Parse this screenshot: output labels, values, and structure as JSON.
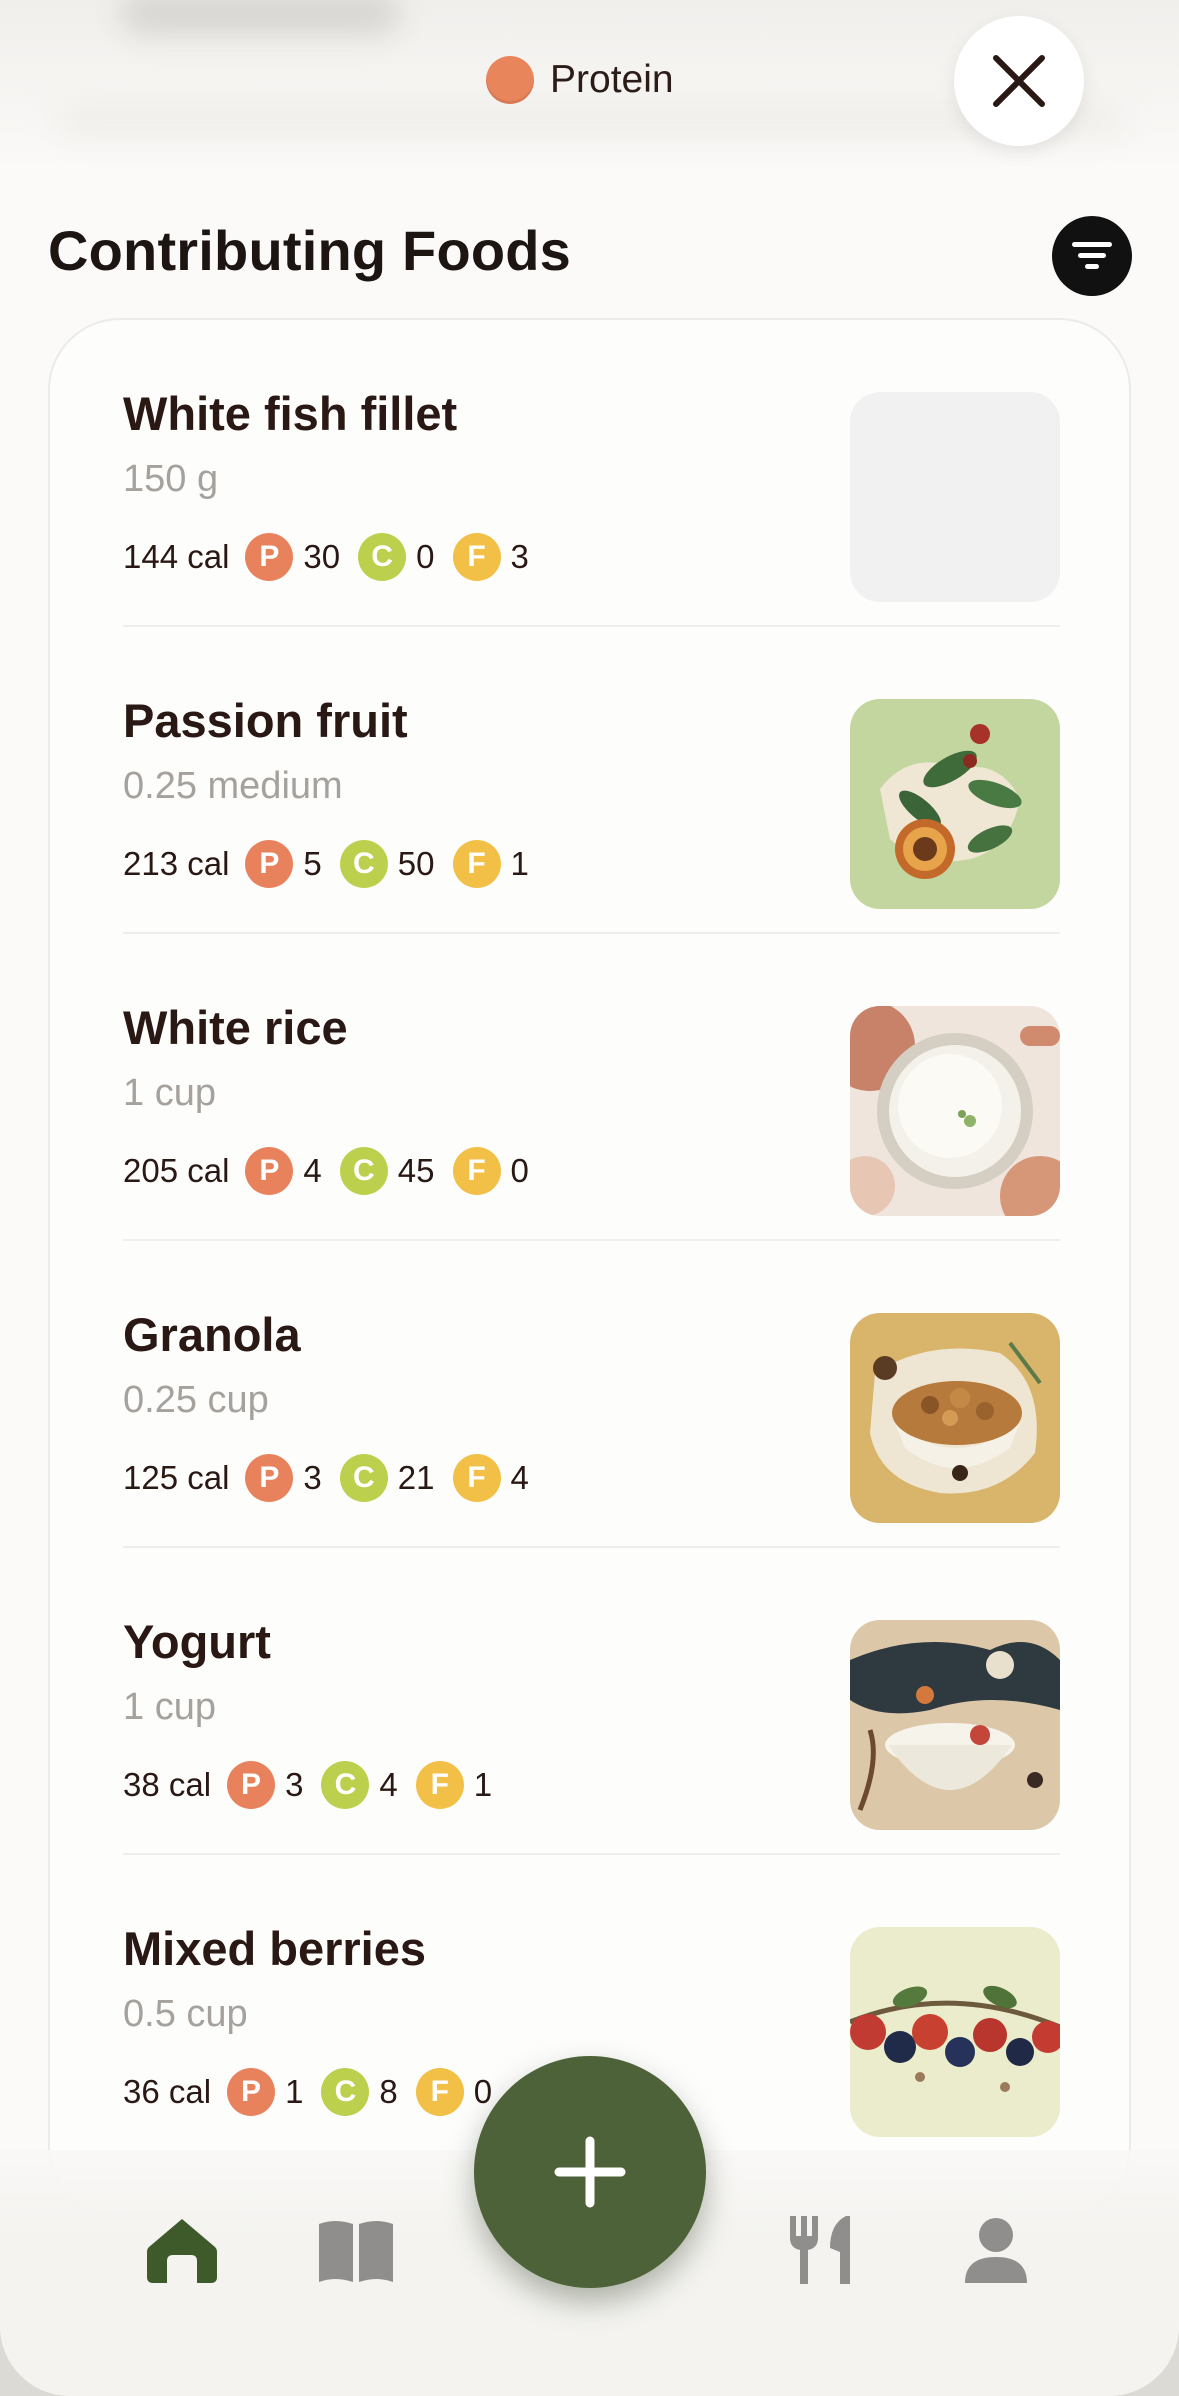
{
  "header": {
    "nutrient_label": "Protein",
    "nutrient_color": "#e8855b",
    "close_icon": "close-icon"
  },
  "title": "Contributing Foods",
  "filter_icon": "filter-icon",
  "foods": [
    {
      "name": "White fish fillet",
      "qty": "150 g",
      "cal": "144 cal",
      "p": "30",
      "c": "0",
      "f": "3",
      "image": "placeholder"
    },
    {
      "name": "Passion fruit",
      "qty": "0.25 medium",
      "cal": "213 cal",
      "p": "5",
      "c": "50",
      "f": "1",
      "image": "passion-fruit-illustration"
    },
    {
      "name": "White rice",
      "qty": "1 cup",
      "cal": "205 cal",
      "p": "4",
      "c": "45",
      "f": "0",
      "image": "rice-bowl-illustration"
    },
    {
      "name": "Granola",
      "qty": "0.25 cup",
      "cal": "125 cal",
      "p": "3",
      "c": "21",
      "f": "4",
      "image": "granola-bowl-illustration"
    },
    {
      "name": "Yogurt",
      "qty": "1 cup",
      "cal": "38 cal",
      "p": "3",
      "c": "4",
      "f": "1",
      "image": "yogurt-bowl-illustration"
    },
    {
      "name": "Mixed berries",
      "qty": "0.5 cup",
      "cal": "36 cal",
      "p": "1",
      "c": "8",
      "f": "0",
      "image": "berries-illustration"
    }
  ],
  "macro_letters": {
    "p": "P",
    "c": "C",
    "f": "F"
  },
  "macro_colors": {
    "p": "#e8825c",
    "c": "#bcd04d",
    "f": "#f2c046"
  },
  "nav": {
    "items": [
      "home-icon",
      "book-icon",
      "add-icon",
      "utensils-icon",
      "profile-icon"
    ],
    "active": "home-icon",
    "active_color": "#3f5a2a",
    "fab_color": "#4d6238"
  }
}
